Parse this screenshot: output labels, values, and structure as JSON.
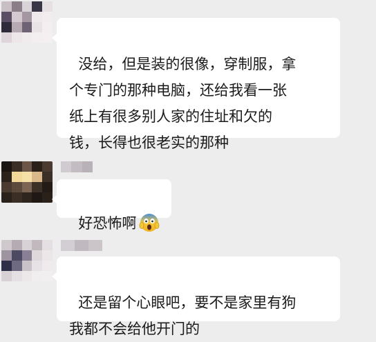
{
  "chat": {
    "messages": [
      {
        "sender_name_visible": false,
        "text": "没给，但是装的很像，穿制服，拿\n个专门的那种电脑，还给我看一张\n纸上有很多别人家的住址和欠的\n钱，长得也很老实的那种",
        "emoji": ""
      },
      {
        "sender_name_visible": false,
        "text": "好恐怖啊",
        "emoji": "screaming-in-fear-emoji"
      },
      {
        "sender_name_visible": false,
        "text": "还是留个心眼吧，要不是家里有狗\n我都不会给他开门的",
        "emoji": ""
      }
    ]
  },
  "colors": {
    "background": "#ededed",
    "bubble": "#ffffff",
    "text": "#1a1a1a"
  }
}
